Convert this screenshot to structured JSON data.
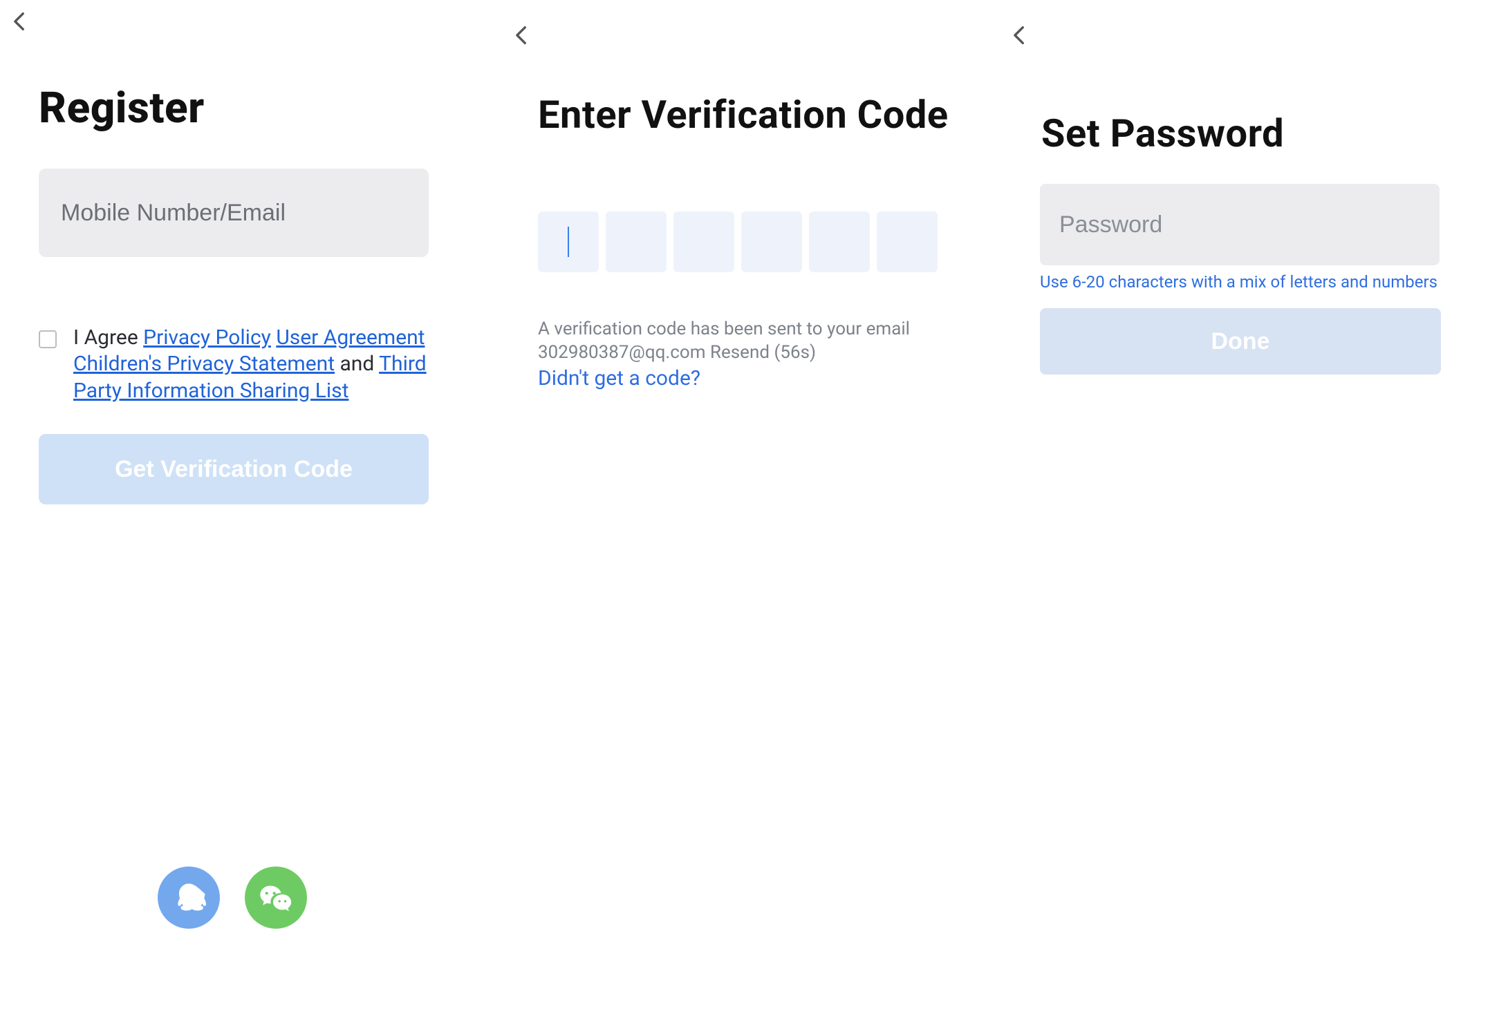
{
  "screen1": {
    "title": "Register",
    "input_placeholder": "Mobile Number/Email",
    "agree": {
      "prefix": "I Agree ",
      "privacy": "Privacy Policy",
      "user_agreement": "User Agreement",
      "children": "Children's Privacy Statement",
      "and": " and ",
      "third_party": "Third Party Information Sharing List"
    },
    "primary_button": "Get Verification Code"
  },
  "screen2": {
    "title": "Enter Verification Code",
    "sent_line1": "A verification code has been sent to your email",
    "sent_line2": "302980387@qq.com Resend (56s)",
    "didnt": "Didn't get a code?",
    "code_boxes": 6,
    "active_index": 0
  },
  "screen3": {
    "title": "Set Password",
    "password_placeholder": "Password",
    "hint": "Use 6-20 characters with a mix of letters and numbers",
    "done": "Done"
  }
}
